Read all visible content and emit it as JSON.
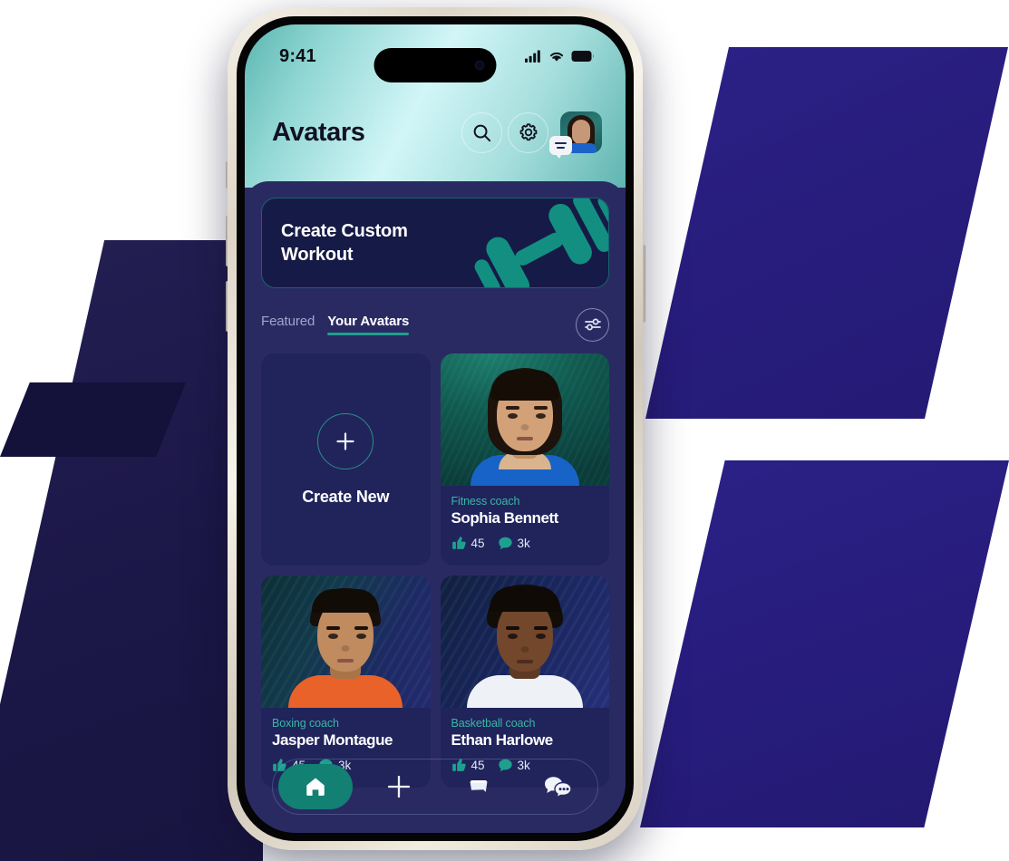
{
  "status_bar": {
    "time": "9:41",
    "cellular_icon": "signal-bars-icon",
    "wifi_icon": "wifi-icon",
    "battery_icon": "battery-icon"
  },
  "app_bar": {
    "title": "Avatars",
    "search_icon": "search-icon",
    "settings_icon": "gear-icon",
    "profile_avatar": "avatar",
    "profile_badge_icon": "chat-bubble-icon"
  },
  "promo": {
    "title": "Create Custom\nWorkout",
    "graphic_icon": "dumbbell-icon",
    "accent_color": "#1fa08f",
    "background_color": "#161a46"
  },
  "tabs": {
    "items": [
      {
        "label": "Featured",
        "active": false
      },
      {
        "label": "Your Avatars",
        "active": true
      }
    ],
    "filter_icon": "sliders-filter-icon"
  },
  "cards": {
    "create_new": {
      "label": "Create New",
      "plus_icon": "plus-icon"
    },
    "items": [
      {
        "role": "Fitness coach",
        "name": "Sophia Bennett",
        "likes": "45",
        "comments": "3k",
        "like_icon": "thumbs-up-icon",
        "comment_icon": "speech-bubble-icon"
      },
      {
        "role": "Boxing coach",
        "name": "Jasper Montague",
        "likes": "45",
        "comments": "3k",
        "like_icon": "thumbs-up-icon",
        "comment_icon": "speech-bubble-icon"
      },
      {
        "role": "Basketball coach",
        "name": "Ethan Harlowe",
        "likes": "45",
        "comments": "3k",
        "like_icon": "thumbs-up-icon",
        "comment_icon": "speech-bubble-icon"
      }
    ]
  },
  "bottom_nav": {
    "items": [
      {
        "icon": "home-icon",
        "active": true
      },
      {
        "icon": "plus-icon",
        "active": false
      },
      {
        "icon": "notes-icon",
        "active": false
      },
      {
        "icon": "chat-icon",
        "active": false
      }
    ],
    "active_color": "#128073"
  },
  "theme": {
    "app_background": "#2a2a63",
    "card_background": "#20245b",
    "accent_teal": "#1fa08f",
    "role_text": "#3bb6a6",
    "header_gradient_start": "#5cb6b2",
    "header_gradient_mid": "#d2f6f8",
    "header_gradient_end": "#5fb5b1"
  }
}
